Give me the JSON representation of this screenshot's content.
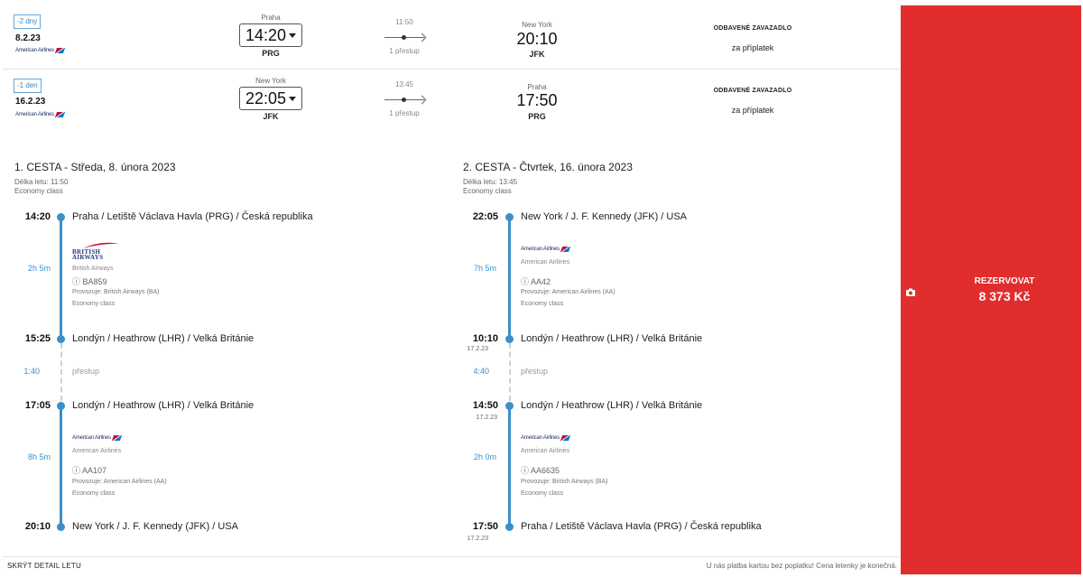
{
  "outbound_row": {
    "shift": "-2 dny",
    "date": "8.2.23",
    "airline_logo": "American Airlines",
    "from_city": "Praha",
    "dep_time": "14:20",
    "from_code": "PRG",
    "duration": "11:50",
    "stops": "1 přestup",
    "to_city": "New York",
    "arr_time": "20:10",
    "to_code": "JFK",
    "baggage_title": "ODBAVENÉ ZAVAZADLO",
    "baggage_sub": "za příplatek"
  },
  "return_row": {
    "shift": "-1 den",
    "date": "16.2.23",
    "airline_logo": "American Airlines",
    "from_city": "New York",
    "dep_time": "22:05",
    "from_code": "JFK",
    "duration": "13:45",
    "stops": "1 přestup",
    "to_city": "Praha",
    "arr_time": "17:50",
    "to_code": "PRG",
    "baggage_title": "ODBAVENÉ ZAVAZADLO",
    "baggage_sub": "za příplatek"
  },
  "leg1": {
    "title": "1. CESTA - Středa, 8. února 2023",
    "duration": "Délka letu: 11:50",
    "class": "Economy class",
    "stop1_time": "14:20",
    "stop1_place": "Praha / Letiště Václava Havla (PRG) / Česká republika",
    "seg1_dur": "2h 5m",
    "seg1_logo_text": "BRITISH AIRWAYS",
    "seg1_airline": "British Airways",
    "seg1_flight": "ⓘ BA859",
    "seg1_operated": "Provozuje: British Airways (BA)",
    "seg1_class": "Economy class",
    "stop2_time": "15:25",
    "stop2_place": "Londýn / Heathrow (LHR) / Velká Británie",
    "transfer_dur": "1:40",
    "transfer_label": "přestup",
    "stop3_time": "17:05",
    "stop3_place": "Londýn / Heathrow (LHR) / Velká Británie",
    "seg2_dur": "8h 5m",
    "seg2_logo": "American Airlines",
    "seg2_airline": "American Airlines",
    "seg2_flight": "ⓘ AA107",
    "seg2_operated": "Provozuje: American Airlines (AA)",
    "seg2_class": "Economy class",
    "stop4_time": "20:10",
    "stop4_place": "New York / J. F. Kennedy (JFK) / USA"
  },
  "leg2": {
    "title": "2. CESTA - Čtvrtek, 16. února 2023",
    "duration": "Délka letu: 13:45",
    "class": "Economy class",
    "stop1_time": "22:05",
    "stop1_place": "New York / J. F. Kennedy (JFK) / USA",
    "seg1_dur": "7h 5m",
    "seg1_logo": "American Airlines",
    "seg1_airline": "American Airlines",
    "seg1_flight": "ⓘ AA42",
    "seg1_operated": "Provozuje: American Airlines (AA)",
    "seg1_class": "Economy class",
    "stop2_time": "10:10",
    "stop2_date": "17.2.23",
    "stop2_place": "Londýn / Heathrow (LHR) / Velká Británie",
    "transfer_dur": "4:40",
    "transfer_label": "přestup",
    "stop3_time": "14:50",
    "stop3_date": "17.2.23",
    "stop3_place": "Londýn / Heathrow (LHR) / Velká Británie",
    "seg2_dur": "2h 0m",
    "seg2_logo": "American Airlines",
    "seg2_airline": "American Airlines",
    "seg2_flight": "ⓘ AA6635",
    "seg2_operated": "Provozuje: British Airways (BA)",
    "seg2_class": "Economy class",
    "stop4_time": "17:50",
    "stop4_date": "17.2.23",
    "stop4_place": "Praha / Letiště Václava Havla (PRG) / Česká republika"
  },
  "footer": {
    "hide_detail": "SKRÝT DETAIL LETU",
    "note": "U nás platba kartou bez poplatku! Cena letenky je konečná."
  },
  "booking": {
    "label": "REZERVOVAT",
    "price": "8 373 Kč",
    "icon": "camera-icon",
    "color": "#e12d2e"
  }
}
